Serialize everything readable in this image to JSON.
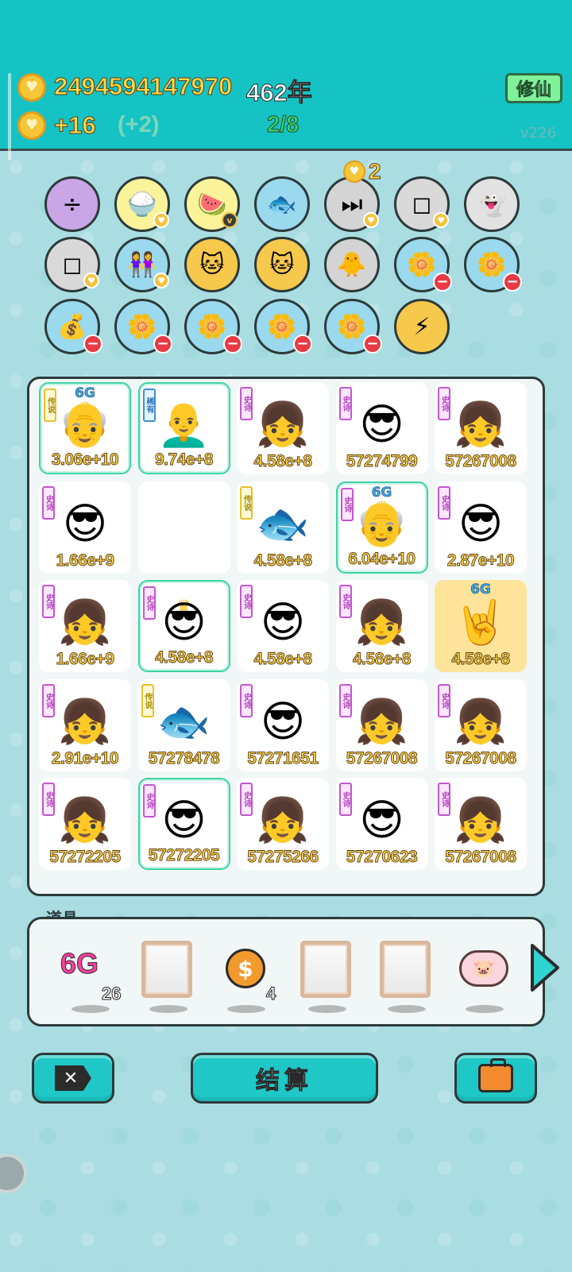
{
  "header": {
    "coins": "2494594147970",
    "years": "462年",
    "income": "+16",
    "income_bonus": "(+2)",
    "progress": "2/8",
    "cultivate_label": "修仙",
    "version": "v226"
  },
  "upgrades": {
    "price": "2",
    "rows": [
      [
        "math-icon",
        "rice-bowl-icon",
        "fruit-basket-icon",
        "fishbowl-icon",
        "skip-icon",
        "sugar-cubes-icon",
        "ghost-icon"
      ],
      [
        "sugar-cubes-icon",
        "twins-icon",
        "cats-icon",
        "cats-icon",
        "chick-icon",
        "flower-pot-icon",
        "flower-pot-icon"
      ],
      [
        "money-bag-icon",
        "flower-pot-icon",
        "flower-pot-icon",
        "flower-pot-icon",
        "flower-pot-icon",
        "lightning-icon"
      ]
    ]
  },
  "board": {
    "cells": [
      {
        "tag": "传说",
        "type": "legend",
        "face": "old-king",
        "value": "3.06e+10",
        "g6": "6G",
        "highlight": true
      },
      {
        "tag": "稀有",
        "type": "rare",
        "face": "bald-man",
        "value": "9.74e+8",
        "highlight": true
      },
      {
        "tag": "史诗",
        "type": "epic",
        "face": "girl",
        "value": "4.58e+8"
      },
      {
        "tag": "史诗",
        "type": "epic",
        "face": "green-cap-man",
        "value": "57274799"
      },
      {
        "tag": "史诗",
        "type": "epic",
        "face": "girl",
        "value": "57267008"
      },
      {
        "tag": "史诗",
        "type": "epic",
        "face": "green-cap-man",
        "value": "1.66e+9"
      },
      {
        "tag": "",
        "type": "",
        "face": "",
        "value": ""
      },
      {
        "tag": "传说",
        "type": "legend",
        "face": "koi-fish",
        "value": "4.58e+8"
      },
      {
        "tag": "史诗",
        "type": "epic",
        "face": "old-king",
        "value": "6.04e+10",
        "g6": "6G",
        "highlight": true
      },
      {
        "tag": "史诗",
        "type": "epic",
        "face": "green-cap-man",
        "value": "2.87e+10"
      },
      {
        "tag": "史诗",
        "type": "epic",
        "face": "girl",
        "value": "1.66e+9"
      },
      {
        "tag": "史诗",
        "type": "epic",
        "face": "green-cap-king",
        "value": "4.58e+8",
        "highlight": true
      },
      {
        "tag": "史诗",
        "type": "epic",
        "face": "green-cap-man",
        "value": "4.58e+8"
      },
      {
        "tag": "史诗",
        "type": "epic",
        "face": "girl",
        "value": "4.58e+8"
      },
      {
        "tag": "",
        "type": "",
        "face": "rock-hand",
        "value": "4.58e+8",
        "g6": "6G",
        "yellow": true
      },
      {
        "tag": "史诗",
        "type": "epic",
        "face": "girl",
        "value": "2.91e+10"
      },
      {
        "tag": "传说",
        "type": "legend",
        "face": "koi-fish",
        "value": "57278478"
      },
      {
        "tag": "史诗",
        "type": "epic",
        "face": "green-cap-man",
        "value": "57271651"
      },
      {
        "tag": "史诗",
        "type": "epic",
        "face": "girl",
        "value": "57267008"
      },
      {
        "tag": "史诗",
        "type": "epic",
        "face": "girl",
        "value": "57267008"
      },
      {
        "tag": "史诗",
        "type": "epic",
        "face": "girl",
        "value": "57272205"
      },
      {
        "tag": "史诗",
        "type": "epic",
        "face": "green-cap-man",
        "value": "57272205",
        "highlight": true
      },
      {
        "tag": "史诗",
        "type": "epic",
        "face": "girl",
        "value": "57275266"
      },
      {
        "tag": "史诗",
        "type": "epic",
        "face": "green-cap-man",
        "value": "57270623"
      },
      {
        "tag": "史诗",
        "type": "epic",
        "face": "girl",
        "value": "57267008"
      }
    ]
  },
  "items": {
    "label": "道具",
    "g6_label": "6G",
    "g6_count": "26",
    "coin_count": "4"
  },
  "buttons": {
    "settle": "结算"
  }
}
